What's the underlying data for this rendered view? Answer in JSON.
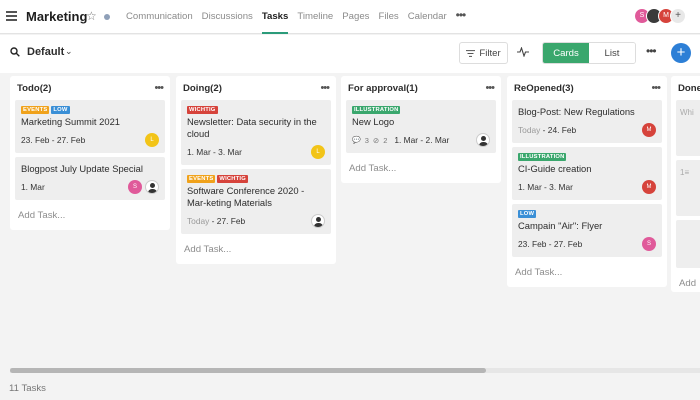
{
  "header": {
    "project": "Marketing",
    "nav": [
      "Communication",
      "Discussions",
      "Tasks",
      "Timeline",
      "Pages",
      "Files",
      "Calendar"
    ],
    "active_nav": "Tasks",
    "avatars": [
      {
        "initial": "S",
        "color": "#e05a9a"
      },
      {
        "initial": "",
        "color": "#3b3b3b"
      },
      {
        "initial": "M",
        "color": "#d6433b"
      },
      {
        "initial": "+",
        "color": "#e8e8e8"
      }
    ]
  },
  "toolbar": {
    "view": "Default",
    "filter_label": "Filter",
    "view_modes": [
      "Cards",
      "List"
    ],
    "active_mode": "Cards",
    "add_label": "+"
  },
  "tag_colors": {
    "EVENTS": "#f0a21b",
    "LOW": "#3a8fd6",
    "WICHTIG": "#d6433b",
    "ILLUSTRATION": "#3aa76d"
  },
  "columns": [
    {
      "title": "Todo(2)",
      "cards": [
        {
          "tags": [
            "EVENTS",
            "LOW"
          ],
          "title": "Marketing Summit 2021",
          "date_prefix": "",
          "date": "23. Feb - 27. Feb",
          "people": [
            {
              "type": "yellow",
              "initial": "L"
            }
          ]
        },
        {
          "tags": [],
          "title": "Blogpost July Update Special",
          "date_prefix": "",
          "date": "1. Mar",
          "people": [
            {
              "type": "pink",
              "initial": "S"
            },
            {
              "type": "photo",
              "initial": ""
            }
          ]
        }
      ]
    },
    {
      "title": "Doing(2)",
      "cards": [
        {
          "tags": [
            "WICHTIG"
          ],
          "title": "Newsletter: Data security in the cloud",
          "date_prefix": "",
          "date": "1. Mar - 3. Mar",
          "people": [
            {
              "type": "yellow",
              "initial": "L"
            }
          ]
        },
        {
          "tags": [
            "EVENTS",
            "WICHTIG"
          ],
          "title": "Software Conference 2020 - Mar-keting Materials",
          "date_prefix": "Today",
          "date": " - 27. Feb",
          "people": [
            {
              "type": "photo",
              "initial": ""
            }
          ]
        }
      ]
    },
    {
      "title": "For approval(1)",
      "cards": [
        {
          "tags": [
            "ILLUSTRATION"
          ],
          "title": "New Logo",
          "date_prefix": "",
          "date": "1. Mar - 2. Mar",
          "counts": {
            "comments": "3",
            "attachments": "2"
          },
          "people": [
            {
              "type": "photo",
              "initial": ""
            }
          ]
        }
      ]
    },
    {
      "title": "ReOpened(3)",
      "cards": [
        {
          "tags": [],
          "title": "Blog-Post: New Regulations",
          "date_prefix": "Today",
          "date": " - 24. Feb",
          "people": [
            {
              "type": "red",
              "initial": "M"
            }
          ]
        },
        {
          "tags": [
            "ILLUSTRATION"
          ],
          "title": "CI-Guide creation",
          "date_prefix": "",
          "date": "1. Mar - 3. Mar",
          "people": [
            {
              "type": "red",
              "initial": "M"
            }
          ]
        },
        {
          "tags": [
            "LOW"
          ],
          "title": "Campain \"Air\": Flyer",
          "date_prefix": "",
          "date": "23. Feb - 27. Feb",
          "people": [
            {
              "type": "pink",
              "initial": "S"
            }
          ]
        }
      ]
    }
  ],
  "add_task_label": "Add Task...",
  "partial_column": {
    "title": "Done",
    "snippets": [
      "Whi",
      "1≡",
      "Add"
    ]
  },
  "footer": {
    "count": "11 Tasks"
  }
}
